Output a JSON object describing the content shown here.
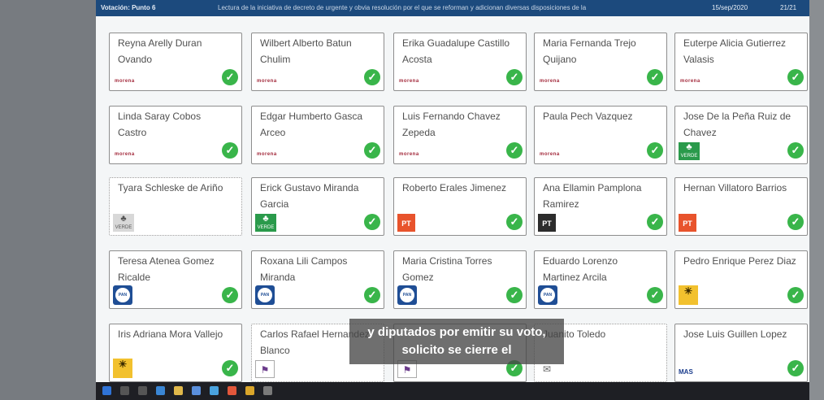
{
  "topbar": {
    "left": "Votación: Punto 6",
    "motion": "Lectura de la iniciativa de decreto de urgente y obvia resolución por el que se reforman y adicionan diversas disposiciones de la",
    "date": "15/sep/2020",
    "count": "21/21"
  },
  "cards": [
    {
      "name": "Reyna Arelly Duran Ovando",
      "party": "morena",
      "voted": true
    },
    {
      "name": "Wilbert Alberto Batun Chulim",
      "party": "morena",
      "voted": true
    },
    {
      "name": "Erika Guadalupe Castillo Acosta",
      "party": "morena",
      "voted": true
    },
    {
      "name": "Maria Fernanda Trejo Quijano",
      "party": "morena",
      "voted": true
    },
    {
      "name": "Euterpe Alicia Gutierrez Valasis",
      "party": "morena",
      "voted": true
    },
    {
      "name": "Linda Saray Cobos Castro",
      "party": "morena",
      "voted": true
    },
    {
      "name": "Edgar Humberto Gasca Arceo",
      "party": "morena",
      "voted": true
    },
    {
      "name": "Luis Fernando Chavez Zepeda",
      "party": "morena",
      "voted": true
    },
    {
      "name": "Paula Pech Vazquez",
      "party": "morena",
      "voted": true
    },
    {
      "name": "Jose De la Peña Ruiz de Chavez",
      "party": "verde",
      "voted": true
    },
    {
      "name": "Tyara Schleske de Ariño",
      "party": "verde-gray",
      "voted": false
    },
    {
      "name": "Erick Gustavo Miranda Garcia",
      "party": "verde",
      "voted": true
    },
    {
      "name": "Roberto Erales Jimenez",
      "party": "pt",
      "voted": true
    },
    {
      "name": "Ana Ellamin Pamplona Ramirez",
      "party": "pt-dark",
      "voted": true
    },
    {
      "name": "Hernan Villatoro Barrios",
      "party": "pt",
      "voted": true
    },
    {
      "name": "Teresa Atenea Gomez Ricalde",
      "party": "pan",
      "voted": true
    },
    {
      "name": "Roxana Lili Campos Miranda",
      "party": "pan",
      "voted": true
    },
    {
      "name": "Maria Cristina Torres Gomez",
      "party": "pan",
      "voted": true
    },
    {
      "name": "Eduardo Lorenzo Martinez Arcila",
      "party": "pan",
      "voted": true
    },
    {
      "name": "Pedro Enrique Perez Diaz",
      "party": "prd",
      "voted": true
    },
    {
      "name": "Iris Adriana Mora Vallejo",
      "party": "prd",
      "voted": true
    },
    {
      "name": "Carlos Rafael Hernandez Blanco",
      "party": "pes",
      "voted": false
    },
    {
      "name": "",
      "party": "pes",
      "voted": true
    },
    {
      "name": "Juanito Toledo",
      "party": "env",
      "voted": false
    },
    {
      "name": "Jose Luis Guillen Lopez",
      "party": "mas",
      "voted": true
    }
  ],
  "logos": {
    "morena": "morena",
    "verde": "VERDE",
    "pt": "PT",
    "pan": "PAN",
    "prd": "PRD",
    "mas": "MAS"
  },
  "subtitle": {
    "line1": "y diputados por emitir su voto,",
    "line2": "solicito se cierre el"
  },
  "colors": {
    "header": "#1c4a7d",
    "check": "#39b54a",
    "morena": "#a2283a",
    "verde": "#2a9a4b",
    "pt": "#e8532c",
    "pan": "#1f4e95",
    "prd": "#f2c12e"
  }
}
